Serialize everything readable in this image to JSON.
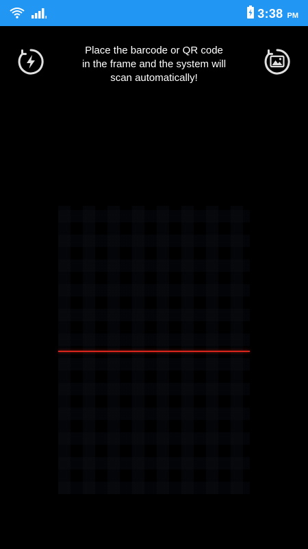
{
  "status_bar": {
    "time": "3:38",
    "ampm": "PM",
    "background_color": "#2196f3",
    "icons": [
      "wifi-icon",
      "signal-icon",
      "battery-charging-icon"
    ]
  },
  "controls": {
    "flash_icon": "flash-icon",
    "gallery_icon": "gallery-icon"
  },
  "instruction": {
    "text": "Place the barcode or QR code\nin the frame and the system will\nscan automatically!"
  },
  "scanner": {
    "scan_line_color": "#d9261c"
  }
}
